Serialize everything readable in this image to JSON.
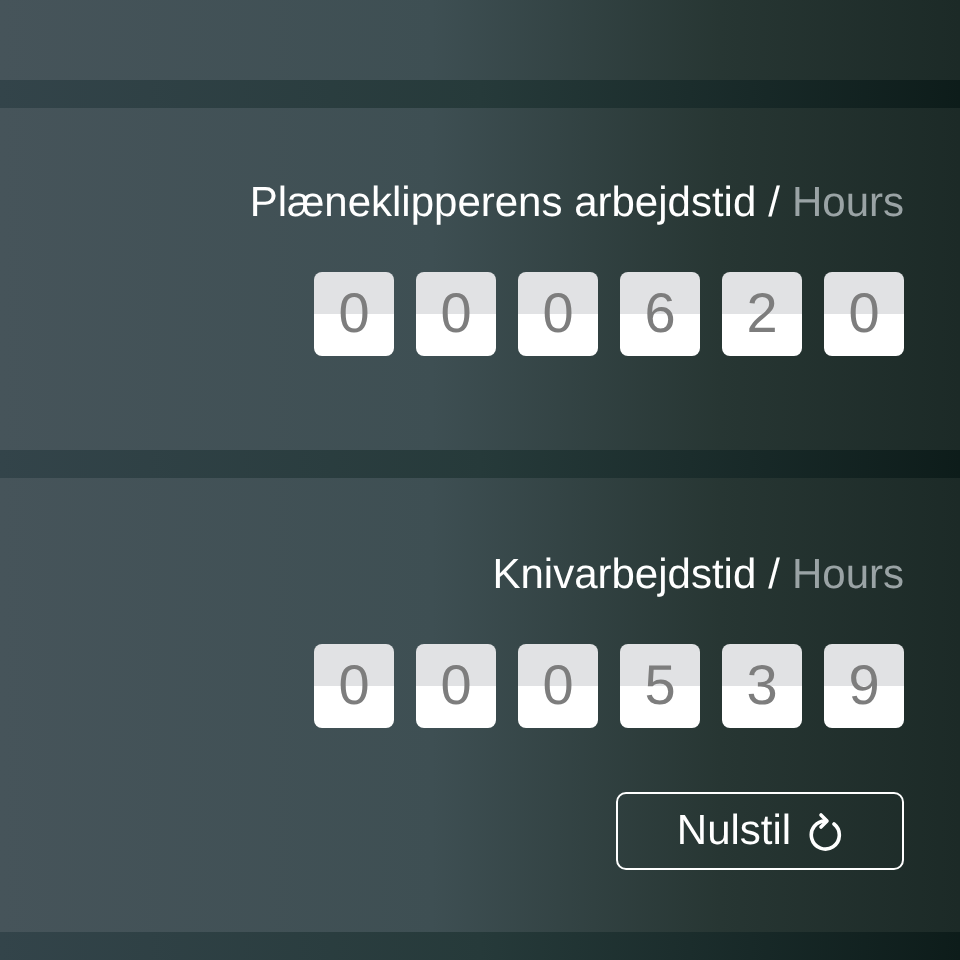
{
  "counters": [
    {
      "label": "Plæneklipperens arbejdstid",
      "separator": "/",
      "unit": "Hours",
      "digits": [
        "0",
        "0",
        "0",
        "6",
        "2",
        "0"
      ]
    },
    {
      "label": "Knivarbejdstid",
      "separator": "/",
      "unit": "Hours",
      "digits": [
        "0",
        "0",
        "0",
        "5",
        "3",
        "9"
      ]
    }
  ],
  "reset_button": {
    "label": "Nulstil"
  }
}
